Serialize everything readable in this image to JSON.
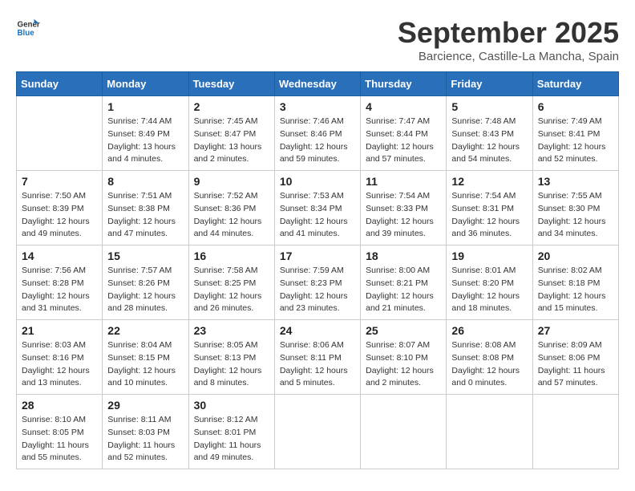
{
  "logo": {
    "line1": "General",
    "line2": "Blue"
  },
  "title": "September 2025",
  "location": "Barcience, Castille-La Mancha, Spain",
  "weekdays": [
    "Sunday",
    "Monday",
    "Tuesday",
    "Wednesday",
    "Thursday",
    "Friday",
    "Saturday"
  ],
  "weeks": [
    [
      {
        "day": "",
        "sunrise": "",
        "sunset": "",
        "daylight": ""
      },
      {
        "day": "1",
        "sunrise": "Sunrise: 7:44 AM",
        "sunset": "Sunset: 8:49 PM",
        "daylight": "Daylight: 13 hours and 4 minutes."
      },
      {
        "day": "2",
        "sunrise": "Sunrise: 7:45 AM",
        "sunset": "Sunset: 8:47 PM",
        "daylight": "Daylight: 13 hours and 2 minutes."
      },
      {
        "day": "3",
        "sunrise": "Sunrise: 7:46 AM",
        "sunset": "Sunset: 8:46 PM",
        "daylight": "Daylight: 12 hours and 59 minutes."
      },
      {
        "day": "4",
        "sunrise": "Sunrise: 7:47 AM",
        "sunset": "Sunset: 8:44 PM",
        "daylight": "Daylight: 12 hours and 57 minutes."
      },
      {
        "day": "5",
        "sunrise": "Sunrise: 7:48 AM",
        "sunset": "Sunset: 8:43 PM",
        "daylight": "Daylight: 12 hours and 54 minutes."
      },
      {
        "day": "6",
        "sunrise": "Sunrise: 7:49 AM",
        "sunset": "Sunset: 8:41 PM",
        "daylight": "Daylight: 12 hours and 52 minutes."
      }
    ],
    [
      {
        "day": "7",
        "sunrise": "Sunrise: 7:50 AM",
        "sunset": "Sunset: 8:39 PM",
        "daylight": "Daylight: 12 hours and 49 minutes."
      },
      {
        "day": "8",
        "sunrise": "Sunrise: 7:51 AM",
        "sunset": "Sunset: 8:38 PM",
        "daylight": "Daylight: 12 hours and 47 minutes."
      },
      {
        "day": "9",
        "sunrise": "Sunrise: 7:52 AM",
        "sunset": "Sunset: 8:36 PM",
        "daylight": "Daylight: 12 hours and 44 minutes."
      },
      {
        "day": "10",
        "sunrise": "Sunrise: 7:53 AM",
        "sunset": "Sunset: 8:34 PM",
        "daylight": "Daylight: 12 hours and 41 minutes."
      },
      {
        "day": "11",
        "sunrise": "Sunrise: 7:54 AM",
        "sunset": "Sunset: 8:33 PM",
        "daylight": "Daylight: 12 hours and 39 minutes."
      },
      {
        "day": "12",
        "sunrise": "Sunrise: 7:54 AM",
        "sunset": "Sunset: 8:31 PM",
        "daylight": "Daylight: 12 hours and 36 minutes."
      },
      {
        "day": "13",
        "sunrise": "Sunrise: 7:55 AM",
        "sunset": "Sunset: 8:30 PM",
        "daylight": "Daylight: 12 hours and 34 minutes."
      }
    ],
    [
      {
        "day": "14",
        "sunrise": "Sunrise: 7:56 AM",
        "sunset": "Sunset: 8:28 PM",
        "daylight": "Daylight: 12 hours and 31 minutes."
      },
      {
        "day": "15",
        "sunrise": "Sunrise: 7:57 AM",
        "sunset": "Sunset: 8:26 PM",
        "daylight": "Daylight: 12 hours and 28 minutes."
      },
      {
        "day": "16",
        "sunrise": "Sunrise: 7:58 AM",
        "sunset": "Sunset: 8:25 PM",
        "daylight": "Daylight: 12 hours and 26 minutes."
      },
      {
        "day": "17",
        "sunrise": "Sunrise: 7:59 AM",
        "sunset": "Sunset: 8:23 PM",
        "daylight": "Daylight: 12 hours and 23 minutes."
      },
      {
        "day": "18",
        "sunrise": "Sunrise: 8:00 AM",
        "sunset": "Sunset: 8:21 PM",
        "daylight": "Daylight: 12 hours and 21 minutes."
      },
      {
        "day": "19",
        "sunrise": "Sunrise: 8:01 AM",
        "sunset": "Sunset: 8:20 PM",
        "daylight": "Daylight: 12 hours and 18 minutes."
      },
      {
        "day": "20",
        "sunrise": "Sunrise: 8:02 AM",
        "sunset": "Sunset: 8:18 PM",
        "daylight": "Daylight: 12 hours and 15 minutes."
      }
    ],
    [
      {
        "day": "21",
        "sunrise": "Sunrise: 8:03 AM",
        "sunset": "Sunset: 8:16 PM",
        "daylight": "Daylight: 12 hours and 13 minutes."
      },
      {
        "day": "22",
        "sunrise": "Sunrise: 8:04 AM",
        "sunset": "Sunset: 8:15 PM",
        "daylight": "Daylight: 12 hours and 10 minutes."
      },
      {
        "day": "23",
        "sunrise": "Sunrise: 8:05 AM",
        "sunset": "Sunset: 8:13 PM",
        "daylight": "Daylight: 12 hours and 8 minutes."
      },
      {
        "day": "24",
        "sunrise": "Sunrise: 8:06 AM",
        "sunset": "Sunset: 8:11 PM",
        "daylight": "Daylight: 12 hours and 5 minutes."
      },
      {
        "day": "25",
        "sunrise": "Sunrise: 8:07 AM",
        "sunset": "Sunset: 8:10 PM",
        "daylight": "Daylight: 12 hours and 2 minutes."
      },
      {
        "day": "26",
        "sunrise": "Sunrise: 8:08 AM",
        "sunset": "Sunset: 8:08 PM",
        "daylight": "Daylight: 12 hours and 0 minutes."
      },
      {
        "day": "27",
        "sunrise": "Sunrise: 8:09 AM",
        "sunset": "Sunset: 8:06 PM",
        "daylight": "Daylight: 11 hours and 57 minutes."
      }
    ],
    [
      {
        "day": "28",
        "sunrise": "Sunrise: 8:10 AM",
        "sunset": "Sunset: 8:05 PM",
        "daylight": "Daylight: 11 hours and 55 minutes."
      },
      {
        "day": "29",
        "sunrise": "Sunrise: 8:11 AM",
        "sunset": "Sunset: 8:03 PM",
        "daylight": "Daylight: 11 hours and 52 minutes."
      },
      {
        "day": "30",
        "sunrise": "Sunrise: 8:12 AM",
        "sunset": "Sunset: 8:01 PM",
        "daylight": "Daylight: 11 hours and 49 minutes."
      },
      {
        "day": "",
        "sunrise": "",
        "sunset": "",
        "daylight": ""
      },
      {
        "day": "",
        "sunrise": "",
        "sunset": "",
        "daylight": ""
      },
      {
        "day": "",
        "sunrise": "",
        "sunset": "",
        "daylight": ""
      },
      {
        "day": "",
        "sunrise": "",
        "sunset": "",
        "daylight": ""
      }
    ]
  ]
}
